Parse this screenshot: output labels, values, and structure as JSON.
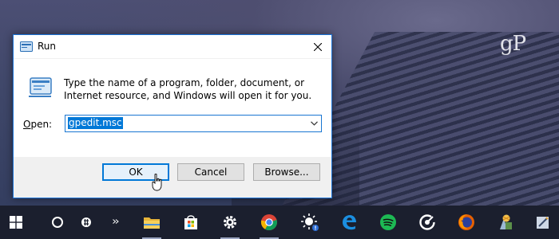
{
  "watermark": "gP",
  "dialog": {
    "title": "Run",
    "description": "Type the name of a program, folder, document, or Internet resource, and Windows will open it for you.",
    "open_label_prefix": "",
    "open_label_hotkey": "O",
    "open_label_rest": "pen:",
    "command_value": "gpedit.msc",
    "buttons": {
      "ok": "OK",
      "cancel": "Cancel",
      "browse": "Browse..."
    }
  },
  "taskbar": {
    "items": [
      {
        "icon": "windows-start-icon"
      },
      {
        "icon": "cortana-icon"
      },
      {
        "icon": "task-view-icon"
      },
      {
        "icon": "overflow-chevron-icon"
      },
      {
        "icon": "file-explorer-icon"
      },
      {
        "icon": "store-icon"
      },
      {
        "icon": "settings-gear-icon"
      },
      {
        "icon": "chrome-icon"
      },
      {
        "icon": "brightness-icon"
      },
      {
        "icon": "edge-icon"
      },
      {
        "icon": "spotify-icon"
      },
      {
        "icon": "groove-music-icon"
      },
      {
        "icon": "firefox-icon"
      },
      {
        "icon": "misc-app-icon"
      },
      {
        "icon": "notes-app-icon"
      }
    ]
  },
  "colors": {
    "accent": "#0078d7",
    "taskbar": "#1b1f2e",
    "dialog_bg": "#f0f0f0"
  }
}
